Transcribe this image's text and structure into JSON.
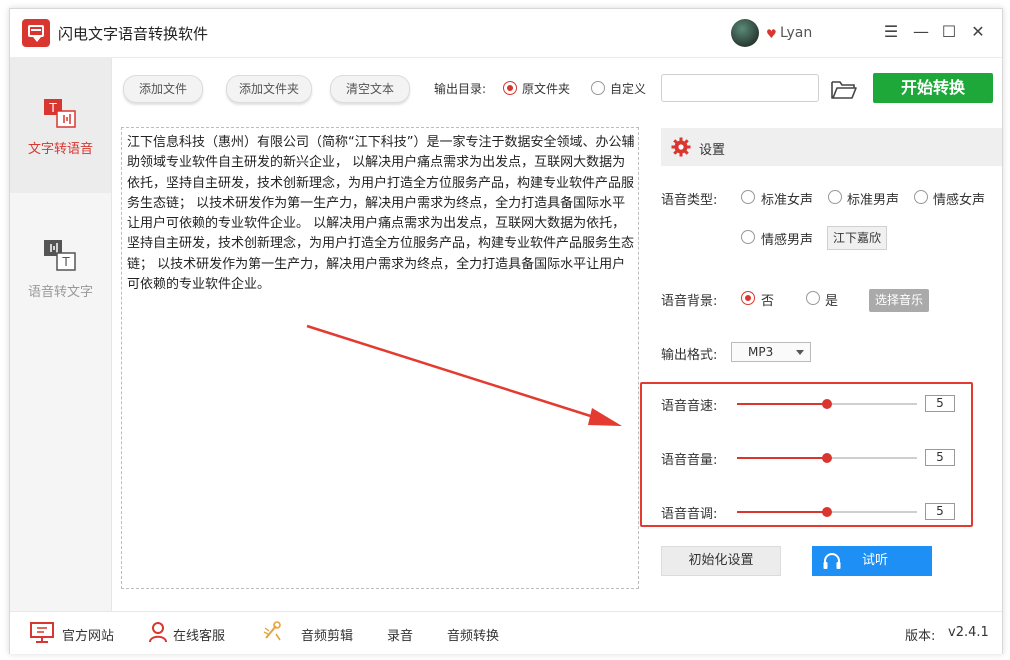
{
  "app": {
    "title": "闪电文字语音转换软件",
    "username": "Lyan"
  },
  "window_controls": {
    "menu": "☰",
    "minimize": "—",
    "maximize": "☐",
    "close": "✕"
  },
  "sidebar": {
    "items": [
      {
        "label": "文字转语音",
        "active": true
      },
      {
        "label": "语音转文字",
        "active": false
      }
    ]
  },
  "toolbar": {
    "add_file": "添加文件",
    "add_folder": "添加文件夹",
    "clear_text": "清空文本",
    "output_dir_label": "输出目录:",
    "option_source_folder": "原文件夹",
    "option_custom": "自定义",
    "output_path_value": "",
    "start_button": "开始转换"
  },
  "editor": {
    "text": "江下信息科技（惠州）有限公司（简称“江下科技”）是一家专注于数据安全领域、办公辅助领域专业软件自主研发的新兴企业， 以解决用户痛点需求为出发点，互联网大数据为依托，坚持自主研发，技术创新理念，为用户打造全方位服务产品，构建专业软件产品服务生态链； 以技术研发作为第一生产力，解决用户需求为终点，全力打造具备国际水平让用户可依赖的专业软件企业。 以解决用户痛点需求为出发点，互联网大数据为依托，坚持自主研发，技术创新理念，为用户打造全方位服务产品，构建专业软件产品服务生态链； 以技术研发作为第一生产力，解决用户需求为终点，全力打造具备国际水平让用户可依赖的专业软件企业。"
  },
  "settings": {
    "title": "设置",
    "voice_type_label": "语音类型:",
    "voice_options": [
      "标准女声",
      "标准男声",
      "情感女声",
      "情感男声"
    ],
    "voice_name_button": "江下嘉欣",
    "background_label": "语音背景:",
    "background_no": "否",
    "background_yes": "是",
    "choose_music": "选择音乐",
    "format_label": "输出格式:",
    "format_value": "MP3",
    "speed_label": "语音音速:",
    "speed_value": "5",
    "speed_level": 0.5,
    "volume_label": "语音音量:",
    "volume_value": "5",
    "volume_level": 0.5,
    "pitch_label": "语音音调:",
    "pitch_value": "5",
    "pitch_level": 0.5,
    "reset_button": "初始化设置",
    "listen_button": "试听"
  },
  "footer": {
    "website": "官方网站",
    "support": "在线客服",
    "audio_edit": "音频剪辑",
    "record": "录音",
    "audio_convert": "音频转换",
    "version_label": "版本:",
    "version_value": "v2.4.1"
  },
  "colors": {
    "accent_red": "#d9362f",
    "start_green": "#1fa83a",
    "listen_blue": "#1e8ff5"
  }
}
